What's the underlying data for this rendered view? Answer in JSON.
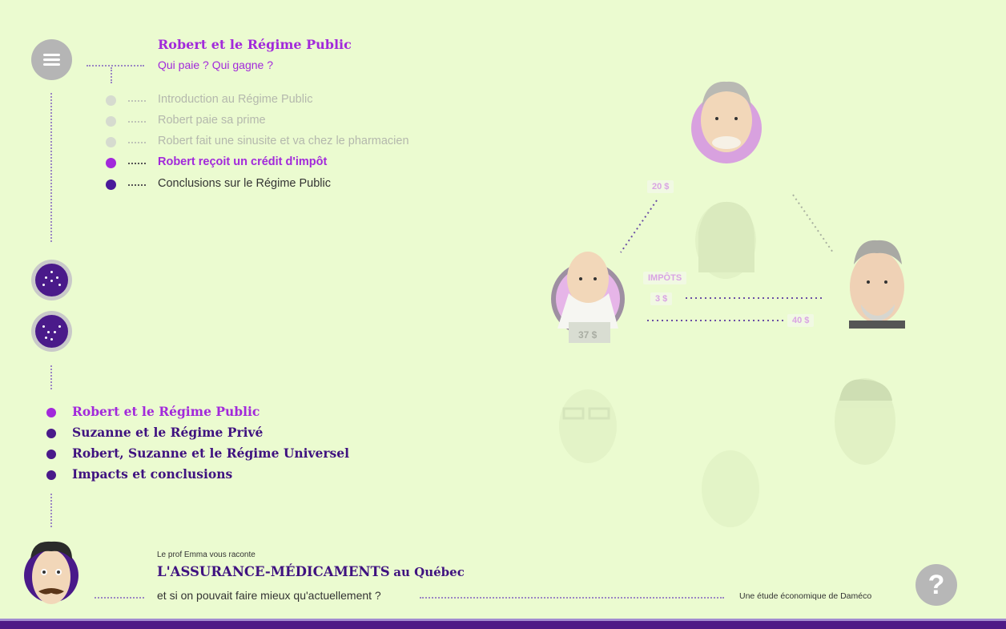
{
  "header": {
    "chapter_title": "Robert et le Régime Public",
    "chapter_subtitle": "Qui paie ? Qui gagne ?"
  },
  "sub_items": [
    {
      "label": "Introduction au Régime Public",
      "state": "done"
    },
    {
      "label": "Robert paie sa prime",
      "state": "done"
    },
    {
      "label": "Robert fait une sinusite et va chez le pharmacien",
      "state": "done"
    },
    {
      "label": "Robert reçoit un crédit d'impôt",
      "state": "current"
    },
    {
      "label": "Conclusions sur le Régime Public",
      "state": "next"
    }
  ],
  "chapters": [
    {
      "label": "Robert et le Régime Public",
      "active": true
    },
    {
      "label": "Suzanne et le Régime Privé",
      "active": false
    },
    {
      "label": "Robert, Suzanne et le Régime Universel",
      "active": false
    },
    {
      "label": "Impacts et conclusions",
      "active": false
    }
  ],
  "diagram": {
    "label_20": "20 $",
    "label_impots": "IMPÔTS",
    "label_3": "3 $",
    "label_40": "40 $",
    "label_37": "37 $"
  },
  "footer": {
    "kicker": "Le prof Emma vous raconte",
    "title_main": "L'ASSURANCE-MÉDICAMENTS",
    "title_rest": "au Québec",
    "subtitle": "et si on pouvait faire mieux qu'actuellement ?",
    "credit": "Une étude économique de Daméco",
    "help_label": "?"
  },
  "colors": {
    "background": "#ebfbd0",
    "accent_magenta": "#a229db",
    "deep_purple": "#3f1280",
    "done_gray": "#b4b8ad"
  },
  "icons": {
    "menu": "hamburger-icon",
    "section": "dots-icon",
    "help": "question-icon"
  }
}
